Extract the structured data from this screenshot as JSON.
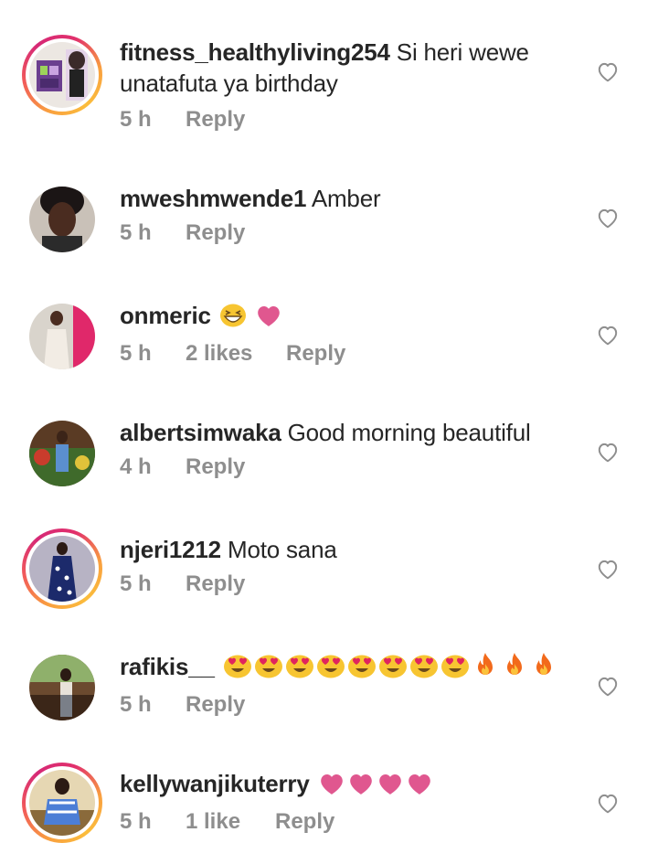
{
  "comments": [
    {
      "username": "fitness_healthyliving254",
      "text": "Si heri wewe",
      "text_line2": "unatafuta ya birthday",
      "time": "5 h",
      "likes": "",
      "reply": "Reply",
      "has_story_ring": true,
      "avatar_icon": "avatar-photo"
    },
    {
      "username": "mweshmwende1",
      "text": "Amber",
      "time": "5 h",
      "likes": "",
      "reply": "Reply",
      "has_story_ring": false,
      "avatar_icon": "avatar-photo"
    },
    {
      "username": "onmeric",
      "text": "",
      "emojis": [
        "grinning-squint-emoji",
        "pink-heart-emoji"
      ],
      "time": "5 h",
      "likes": "2 likes",
      "reply": "Reply",
      "has_story_ring": false,
      "avatar_icon": "avatar-photo"
    },
    {
      "username": "albertsimwaka",
      "text": "Good morning beautiful",
      "time": "4 h",
      "likes": "",
      "reply": "Reply",
      "has_story_ring": false,
      "avatar_icon": "avatar-photo"
    },
    {
      "username": "njeri1212",
      "text": "Moto sana",
      "time": "5 h",
      "likes": "",
      "reply": "Reply",
      "has_story_ring": true,
      "avatar_icon": "avatar-photo"
    },
    {
      "username": "rafikis__",
      "text": "",
      "emojis": [
        "heart-eyes-emoji",
        "heart-eyes-emoji",
        "heart-eyes-emoji",
        "heart-eyes-emoji",
        "heart-eyes-emoji",
        "heart-eyes-emoji",
        "heart-eyes-emoji",
        "heart-eyes-emoji",
        "fire-emoji",
        "fire-emoji",
        "fire-emoji"
      ],
      "time": "5 h",
      "likes": "",
      "reply": "Reply",
      "has_story_ring": false,
      "avatar_icon": "avatar-photo"
    },
    {
      "username": "kellywanjikuterry",
      "text": "",
      "emojis": [
        "pink-heart-emoji",
        "pink-heart-emoji",
        "pink-heart-emoji",
        "pink-heart-emoji"
      ],
      "time": "5 h",
      "likes": "1 like",
      "reply": "Reply",
      "has_story_ring": true,
      "avatar_icon": "avatar-photo"
    }
  ],
  "colors": {
    "username": "#262626",
    "meta": "#8e8e8e",
    "heart_outline": "#8e8e8e",
    "pink_heart": "#e0578f",
    "story_ring": [
      "#f9a03f",
      "#d62976"
    ]
  }
}
